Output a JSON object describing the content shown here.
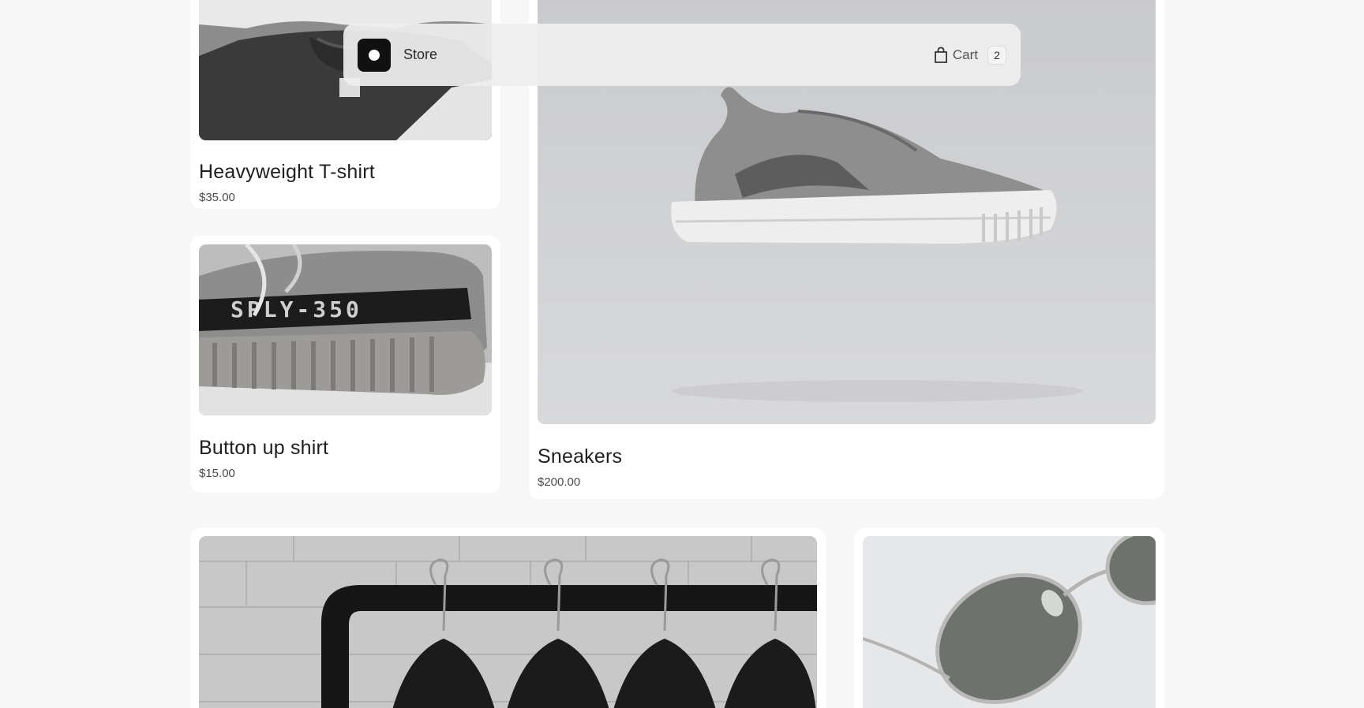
{
  "navbar": {
    "logo_icon": "store-logo-icon",
    "store_name": "Store",
    "cart_icon": "shopping-bag-icon",
    "cart_label": "Cart",
    "cart_count": "2"
  },
  "products": [
    {
      "id": "tshirt",
      "title": "Heavyweight T-shirt",
      "price": "$35.00",
      "image": "tshirt-photo"
    },
    {
      "id": "button-shirt",
      "title": "Button up shirt",
      "price": "$15.00",
      "image": "sneaker-closeup-photo",
      "print": "SPLY-350"
    },
    {
      "id": "sneakers",
      "title": "Sneakers",
      "price": "$200.00",
      "image": "sneaker-photo"
    },
    {
      "id": "rack",
      "image": "clothing-rack-photo"
    },
    {
      "id": "glasses",
      "image": "sunglasses-photo"
    }
  ],
  "colors": {
    "background": "#f7f7f7",
    "card": "#ffffff",
    "logo": "#111111"
  }
}
